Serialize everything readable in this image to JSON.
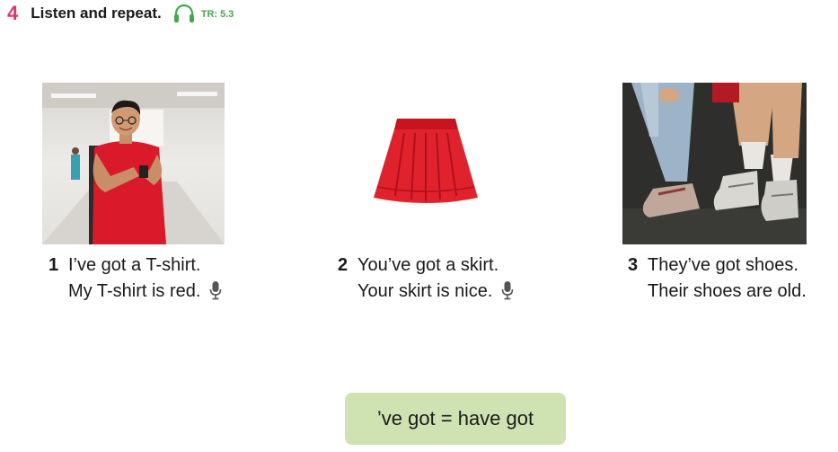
{
  "exercise": {
    "number": "4",
    "instruction": "Listen and repeat.",
    "track": "TR: 5.3"
  },
  "items": [
    {
      "number": "1",
      "line1": "I’ve got a T-shirt.",
      "line2": "My T-shirt is red.",
      "mic": true
    },
    {
      "number": "2",
      "line1": "You’ve got a skirt.",
      "line2": "Your skirt is nice.",
      "mic": true
    },
    {
      "number": "3",
      "line1": "They’ve got shoes.",
      "line2": "Their shoes are old.",
      "mic": false
    }
  ],
  "note": "’ve got = have got",
  "colors": {
    "exercise_number": "#e0336e",
    "track": "#43a84a",
    "note_bg": "#cfe3b2"
  },
  "icons": [
    "headphones-icon",
    "microphone-icon"
  ]
}
